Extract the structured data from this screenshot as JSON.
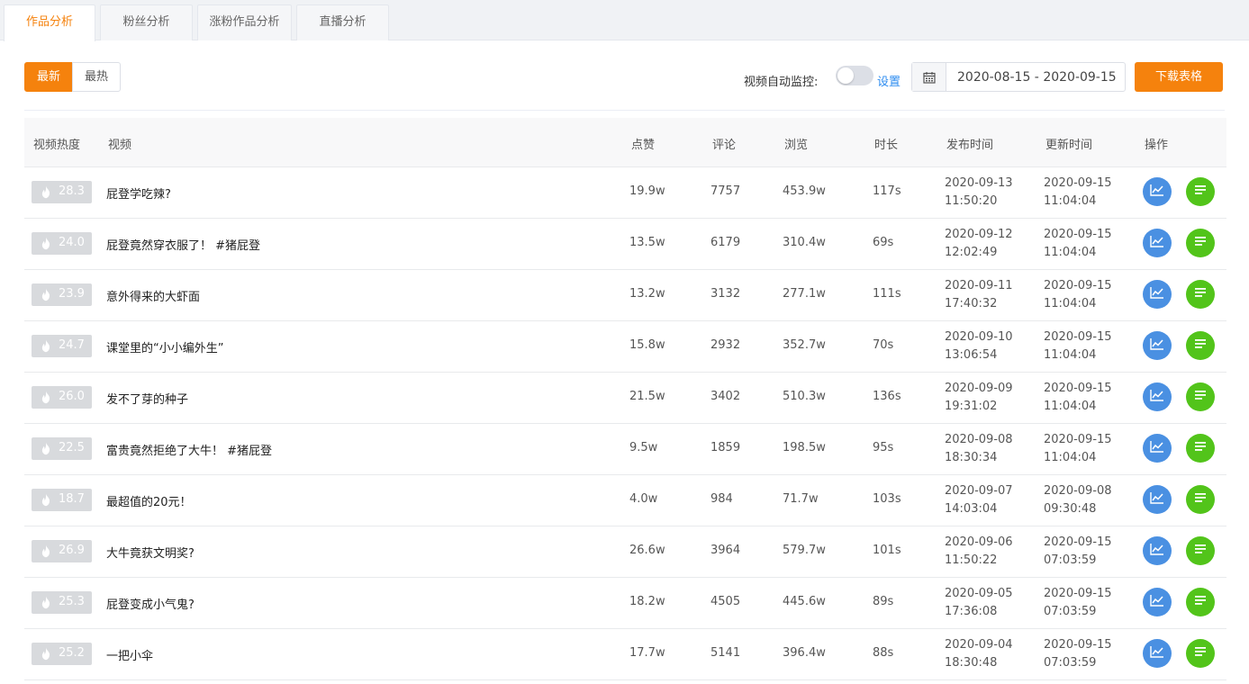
{
  "tabs": [
    {
      "label": "作品分析",
      "active": true
    },
    {
      "label": "粉丝分析",
      "active": false
    },
    {
      "label": "涨粉作品分析",
      "active": false
    },
    {
      "label": "直播分析",
      "active": false
    }
  ],
  "toolbar": {
    "sort_new": "最新",
    "sort_hot": "最热",
    "monitor_label": "视频自动监控:",
    "monitor_enabled": false,
    "settings_link": "设置",
    "date_range": "2020-08-15 - 2020-09-15",
    "download_label": "下载表格"
  },
  "colors": {
    "accent": "#f5820d",
    "chart_button": "#4a90e2",
    "detail_button": "#52c41a",
    "link": "#2d8cf0"
  },
  "table": {
    "headers": {
      "heat": "视频热度",
      "video": "视频",
      "likes": "点赞",
      "comments": "评论",
      "views": "浏览",
      "duration": "时长",
      "published": "发布时间",
      "updated": "更新时间",
      "actions": "操作"
    },
    "rows": [
      {
        "heat": "28.3",
        "title": "屁登学吃辣?",
        "likes": "19.9w",
        "comments": "7757",
        "views": "453.9w",
        "duration": "117s",
        "pub_date": "2020-09-13",
        "pub_time": "11:50:20",
        "upd_date": "2020-09-15",
        "upd_time": "11:04:04"
      },
      {
        "heat": "24.0",
        "title": "屁登竟然穿衣服了！ #猪屁登",
        "likes": "13.5w",
        "comments": "6179",
        "views": "310.4w",
        "duration": "69s",
        "pub_date": "2020-09-12",
        "pub_time": "12:02:49",
        "upd_date": "2020-09-15",
        "upd_time": "11:04:04"
      },
      {
        "heat": "23.9",
        "title": "意外得来的大虾面",
        "likes": "13.2w",
        "comments": "3132",
        "views": "277.1w",
        "duration": "111s",
        "pub_date": "2020-09-11",
        "pub_time": "17:40:32",
        "upd_date": "2020-09-15",
        "upd_time": "11:04:04"
      },
      {
        "heat": "24.7",
        "title": "课堂里的“小小编外生”",
        "likes": "15.8w",
        "comments": "2932",
        "views": "352.7w",
        "duration": "70s",
        "pub_date": "2020-09-10",
        "pub_time": "13:06:54",
        "upd_date": "2020-09-15",
        "upd_time": "11:04:04"
      },
      {
        "heat": "26.0",
        "title": "发不了芽的种子",
        "likes": "21.5w",
        "comments": "3402",
        "views": "510.3w",
        "duration": "136s",
        "pub_date": "2020-09-09",
        "pub_time": "19:31:02",
        "upd_date": "2020-09-15",
        "upd_time": "11:04:04"
      },
      {
        "heat": "22.5",
        "title": "富贵竟然拒绝了大牛！ #猪屁登",
        "likes": "9.5w",
        "comments": "1859",
        "views": "198.5w",
        "duration": "95s",
        "pub_date": "2020-09-08",
        "pub_time": "18:30:34",
        "upd_date": "2020-09-15",
        "upd_time": "11:04:04"
      },
      {
        "heat": "18.7",
        "title": "最超值的20元！",
        "likes": "4.0w",
        "comments": "984",
        "views": "71.7w",
        "duration": "103s",
        "pub_date": "2020-09-07",
        "pub_time": "14:03:04",
        "upd_date": "2020-09-08",
        "upd_time": "09:30:48"
      },
      {
        "heat": "26.9",
        "title": "大牛竟获文明奖?",
        "likes": "26.6w",
        "comments": "3964",
        "views": "579.7w",
        "duration": "101s",
        "pub_date": "2020-09-06",
        "pub_time": "11:50:22",
        "upd_date": "2020-09-15",
        "upd_time": "07:03:59"
      },
      {
        "heat": "25.3",
        "title": "屁登变成小气鬼?",
        "likes": "18.2w",
        "comments": "4505",
        "views": "445.6w",
        "duration": "89s",
        "pub_date": "2020-09-05",
        "pub_time": "17:36:08",
        "upd_date": "2020-09-15",
        "upd_time": "07:03:59"
      },
      {
        "heat": "25.2",
        "title": "一把小伞",
        "likes": "17.7w",
        "comments": "5141",
        "views": "396.4w",
        "duration": "88s",
        "pub_date": "2020-09-04",
        "pub_time": "18:30:48",
        "upd_date": "2020-09-15",
        "upd_time": "07:03:59"
      }
    ]
  }
}
